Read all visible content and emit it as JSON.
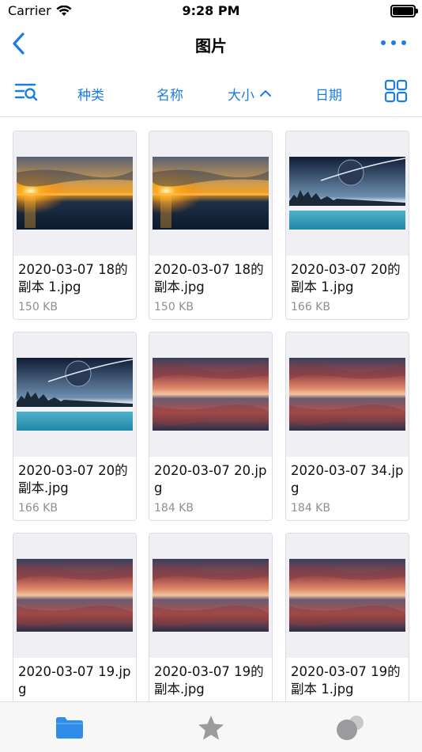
{
  "status_bar": {
    "carrier": "Carrier",
    "time": "9:28 PM"
  },
  "nav": {
    "title": "图片"
  },
  "toolbar": {
    "sort_kind": "种类",
    "sort_name": "名称",
    "sort_size": "大小",
    "sort_date": "日期"
  },
  "files": [
    {
      "name": "2020-03-07  18的副本 1.jpg",
      "size": "150 KB",
      "thumb": "sunset"
    },
    {
      "name": "2020-03-07  18的副本.jpg",
      "size": "150 KB",
      "thumb": "sunset"
    },
    {
      "name": "2020-03-07  20的副本 1.jpg",
      "size": "166 KB",
      "thumb": "planet"
    },
    {
      "name": "2020-03-07  20的副本.jpg",
      "size": "166 KB",
      "thumb": "planet"
    },
    {
      "name": "2020-03-07 20.jpg",
      "size": "184 KB",
      "thumb": "dusk"
    },
    {
      "name": "2020-03-07 34.jpg",
      "size": "184 KB",
      "thumb": "dusk"
    },
    {
      "name": "2020-03-07 19.jpg",
      "size": "",
      "thumb": "dusk"
    },
    {
      "name": "2020-03-07  19的副本.jpg",
      "size": "",
      "thumb": "dusk"
    },
    {
      "name": "2020-03-07  19的副本 1.jpg",
      "size": "",
      "thumb": "dusk"
    }
  ],
  "colors": {
    "accent": "#1a7de2",
    "secondary_text": "#8e8e93"
  },
  "icons": {
    "back": "chevron-left-icon",
    "more": "ellipsis-icon",
    "filter": "filter-search-icon",
    "grid": "grid-view-icon",
    "tab_files": "folder-icon",
    "tab_favorites": "star-icon",
    "tab_other": "circles-icon"
  }
}
